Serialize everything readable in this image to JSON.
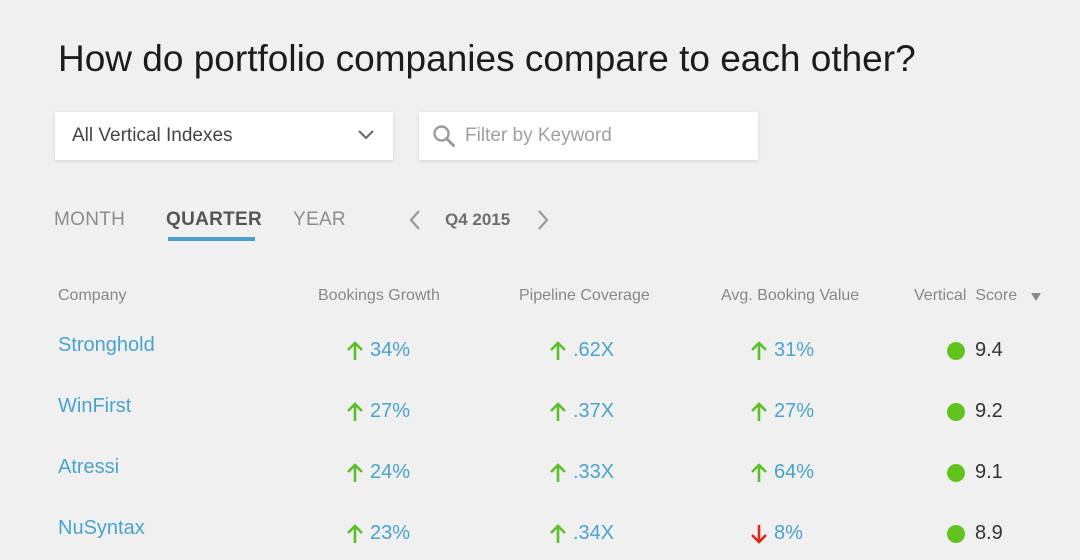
{
  "title": "How do portfolio companies compare to each other?",
  "filters": {
    "vertical_dropdown": {
      "selected": "All Vertical Indexes"
    },
    "search": {
      "placeholder": "Filter by Keyword",
      "value": ""
    }
  },
  "period_tabs": [
    {
      "label": "MONTH",
      "active": false
    },
    {
      "label": "QUARTER",
      "active": true
    },
    {
      "label": "YEAR",
      "active": false
    }
  ],
  "period_nav": {
    "label": "Q4 2015"
  },
  "table": {
    "headers": [
      "Company",
      "Bookings Growth",
      "Pipeline Coverage",
      "Avg. Booking Value",
      "Vertical  Score"
    ],
    "rows": [
      {
        "company": "Stronghold",
        "bookings_growth": "34%",
        "bookings_dir": "up",
        "pipeline": ".62X",
        "pipeline_dir": "up",
        "avg_booking": "31%",
        "avg_booking_dir": "up",
        "score": "9.4"
      },
      {
        "company": "WinFirst",
        "bookings_growth": "27%",
        "bookings_dir": "up",
        "pipeline": ".37X",
        "pipeline_dir": "up",
        "avg_booking": "27%",
        "avg_booking_dir": "up",
        "score": "9.2"
      },
      {
        "company": "Atressi",
        "bookings_growth": "24%",
        "bookings_dir": "up",
        "pipeline": ".33X",
        "pipeline_dir": "up",
        "avg_booking": "64%",
        "avg_booking_dir": "up",
        "score": "9.1"
      },
      {
        "company": "NuSyntax",
        "bookings_growth": "23%",
        "bookings_dir": "up",
        "pipeline": ".34X",
        "pipeline_dir": "up",
        "avg_booking": "8%",
        "avg_booking_dir": "down",
        "score": "8.9"
      }
    ]
  },
  "colors": {
    "up": "#5cbf2a",
    "down": "#e0261b",
    "link": "#4aa3cc",
    "score_dot": "#62c31f",
    "tab_underline": "#4a9fc8"
  },
  "icons": {
    "dropdown": "chevron-down-icon",
    "search": "search-icon",
    "prev": "chevron-left-icon",
    "next": "chevron-right-icon",
    "sort": "sort-desc-icon",
    "up": "arrow-up-icon",
    "down": "arrow-down-icon",
    "score": "status-dot-icon"
  }
}
